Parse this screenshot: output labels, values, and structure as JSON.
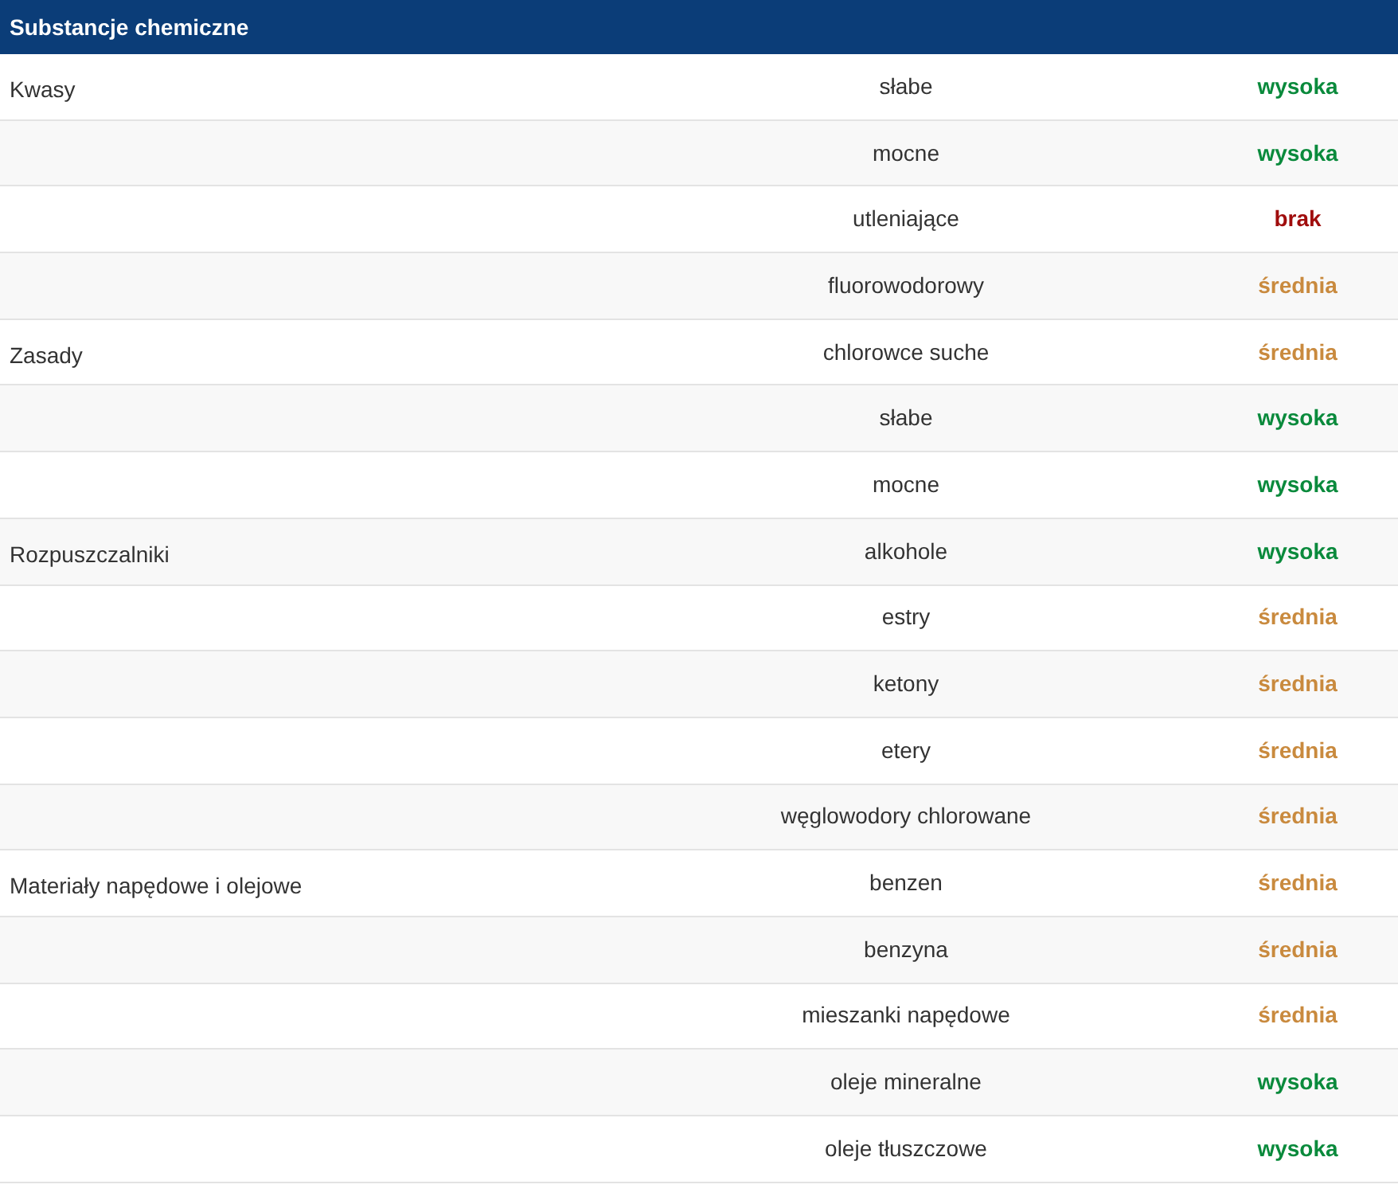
{
  "table": {
    "header": "Substancje chemiczne",
    "rows": [
      {
        "group": "Kwasy",
        "substance": "słabe",
        "resistance": "wysoka",
        "color": "#0a8a3c"
      },
      {
        "substance": "mocne",
        "resistance": "wysoka",
        "color": "#0a8a3c"
      },
      {
        "substance": "utleniające",
        "resistance": "brak",
        "color": "#a00d0d"
      },
      {
        "substance": "fluorowodorowy",
        "resistance": "średnia",
        "color": "#c98a3e"
      },
      {
        "group": "Zasady",
        "substance": "chlorowce suche",
        "resistance": "średnia",
        "color": "#c98a3e"
      },
      {
        "substance": "słabe",
        "resistance": "wysoka",
        "color": "#0a8a3c"
      },
      {
        "substance": "mocne",
        "resistance": "wysoka",
        "color": "#0a8a3c"
      },
      {
        "group": "Rozpuszczalniki",
        "substance": "alkohole",
        "resistance": "wysoka",
        "color": "#0a8a3c"
      },
      {
        "substance": "estry",
        "resistance": "średnia",
        "color": "#c98a3e"
      },
      {
        "substance": "ketony",
        "resistance": "średnia",
        "color": "#c98a3e"
      },
      {
        "substance": "etery",
        "resistance": "średnia",
        "color": "#c98a3e"
      },
      {
        "substance": "węglowodory chlorowane",
        "resistance": "średnia",
        "color": "#c98a3e"
      },
      {
        "group": "Materiały napędowe i olejowe",
        "substance": "benzen",
        "resistance": "średnia",
        "color": "#c98a3e"
      },
      {
        "substance": "benzyna",
        "resistance": "średnia",
        "color": "#c98a3e"
      },
      {
        "substance": "mieszanki napędowe",
        "resistance": "średnia",
        "color": "#c98a3e"
      },
      {
        "substance": "oleje mineralne",
        "resistance": "wysoka",
        "color": "#0a8a3c"
      },
      {
        "substance": "oleje tłuszczowe",
        "resistance": "wysoka",
        "color": "#0a8a3c"
      }
    ]
  }
}
